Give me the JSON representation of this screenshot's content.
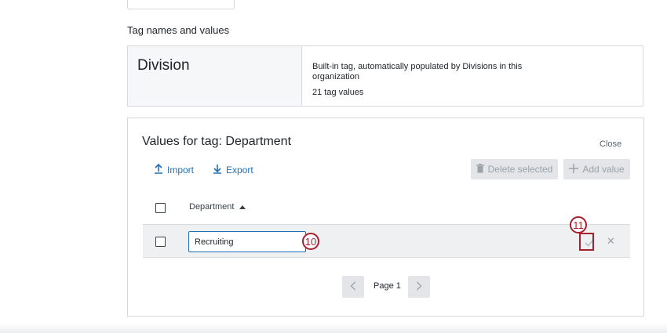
{
  "section": {
    "title": "Tag names and values"
  },
  "tag_card": {
    "name": "Division",
    "description": "Built-in tag, automatically populated by Divisions in this organization",
    "count": "21 tag values"
  },
  "values_panel": {
    "title": "Values for tag: Department",
    "close_label": "Close",
    "import_label": "Import",
    "export_label": "Export",
    "delete_selected_label": "Delete selected",
    "add_value_label": "Add value",
    "column_header": "Department",
    "edit_row": {
      "value": "Recruiting"
    },
    "pagination": {
      "page_label": "Page 1"
    }
  },
  "annotations": {
    "marker_10": "10",
    "marker_11": "11"
  },
  "colors": {
    "accent": "#1f6fb2",
    "marker": "#a81f2e",
    "disabled": "#e3e5e8"
  }
}
